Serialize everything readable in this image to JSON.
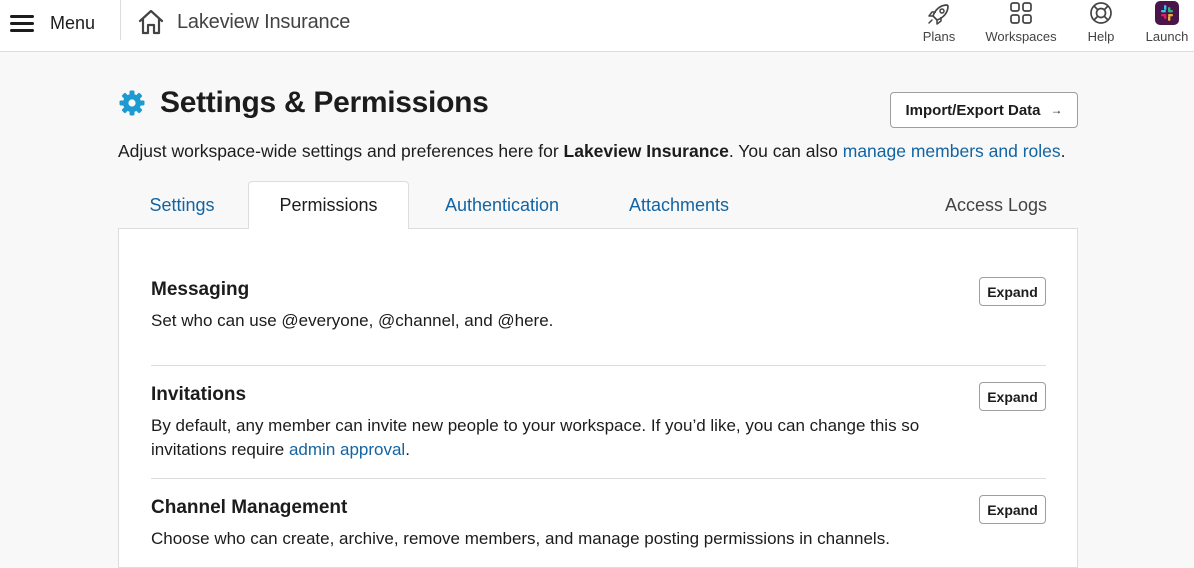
{
  "topbar": {
    "menu_label": "Menu",
    "workspace_name": "Lakeview Insurance",
    "nav": [
      {
        "label": "Plans",
        "icon": "rocket-icon"
      },
      {
        "label": "Workspaces",
        "icon": "grid-icon"
      },
      {
        "label": "Help",
        "icon": "lifebuoy-icon"
      },
      {
        "label": "Launch",
        "icon": "slack-logo-icon"
      }
    ]
  },
  "page": {
    "title": "Settings & Permissions",
    "import_export_label": "Import/Export Data",
    "subtitle_prefix": "Adjust workspace-wide settings and preferences here for ",
    "subtitle_workspace": "Lakeview Insurance",
    "subtitle_middle": ". You can also ",
    "subtitle_link": "manage members and roles",
    "subtitle_suffix": "."
  },
  "tabs": [
    {
      "label": "Settings",
      "active": false
    },
    {
      "label": "Permissions",
      "active": true
    },
    {
      "label": "Authentication",
      "active": false
    },
    {
      "label": "Attachments",
      "active": false
    },
    {
      "label": "Access Logs",
      "active": false
    }
  ],
  "sections": [
    {
      "title": "Messaging",
      "description": "Set who can use @everyone, @channel, and @here.",
      "button": "Expand"
    },
    {
      "title": "Invitations",
      "description_prefix": "By default, any member can invite new people to your workspace. If you’d like, you can change this so invitations require ",
      "description_link": "admin approval",
      "description_suffix": ".",
      "button": "Expand"
    },
    {
      "title": "Channel Management",
      "description": "Choose who can create, archive, remove members, and manage posting permissions in channels.",
      "button": "Expand"
    }
  ],
  "colors": {
    "link": "#1264a3",
    "gear": "#1d9bd1",
    "text": "#1d1c1d"
  }
}
